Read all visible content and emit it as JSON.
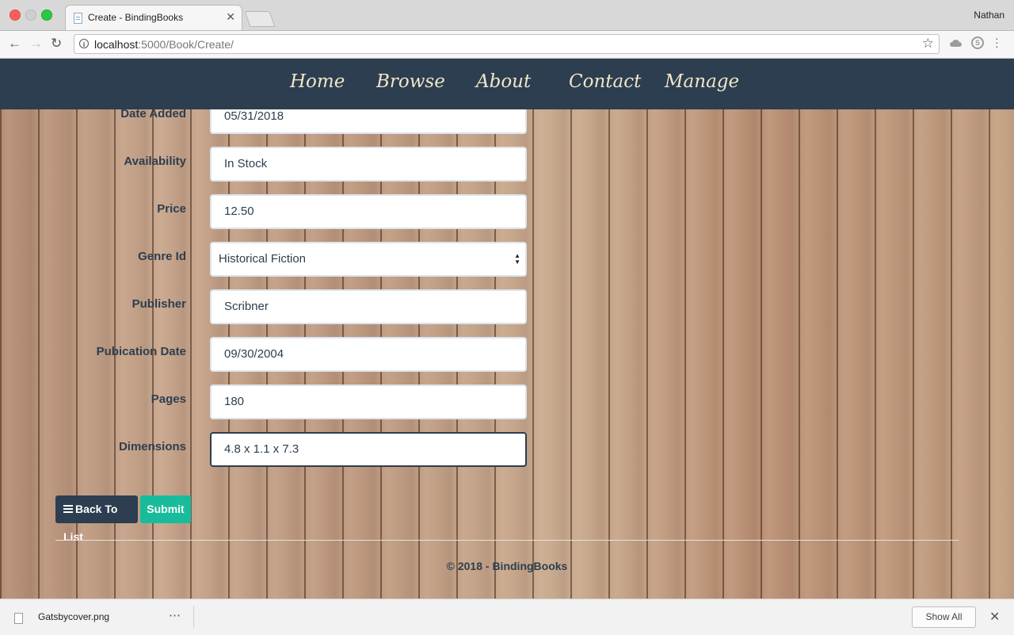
{
  "browser": {
    "tab_title": "Create - BindingBooks",
    "profile_name": "Nathan",
    "url_host": "localhost",
    "url_rest": ":5000/Book/Create/"
  },
  "nav": {
    "links": [
      "Home",
      "Browse",
      "About",
      "Contact",
      "Manage"
    ]
  },
  "form": {
    "fields": [
      {
        "label": "Date Added",
        "value": "05/31/2018"
      },
      {
        "label": "Availability",
        "value": "In Stock"
      },
      {
        "label": "Price",
        "value": "12.50"
      },
      {
        "label": "Genre Id",
        "value": "Historical Fiction"
      },
      {
        "label": "Publisher",
        "value": "Scribner"
      },
      {
        "label": "Pubication Date",
        "value": "09/30/2004"
      },
      {
        "label": "Pages",
        "value": "180"
      },
      {
        "label": "Dimensions",
        "value": "4.8 x 1.1 x 7.3"
      }
    ],
    "back_button": "Back To List",
    "submit_button": "Submit"
  },
  "footer": {
    "text": "© 2018 - BindingBooks"
  },
  "downloads": {
    "file_name": "Gatsbycover.png",
    "menu_glyph": "⋯",
    "show_all": "Show All"
  },
  "colors": {
    "navbar": "#2c3e50",
    "submit": "#18bc9c",
    "nav_text": "#f1e6c8"
  }
}
